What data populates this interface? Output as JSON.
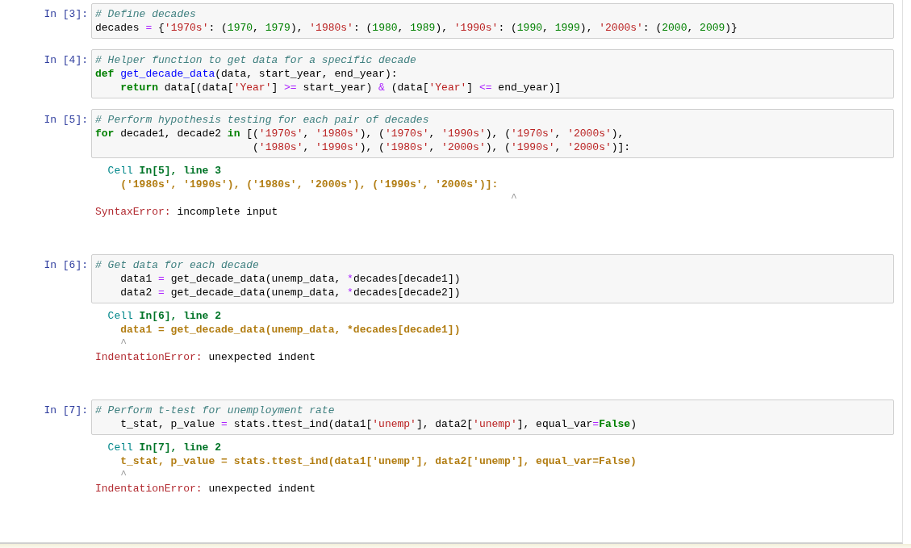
{
  "cells": [
    {
      "prompt": "In [3]:",
      "input": [
        [
          {
            "kind": "comment",
            "text": "# Define decades"
          }
        ],
        [
          {
            "kind": "plain",
            "text": "decades "
          },
          {
            "kind": "operator",
            "text": "="
          },
          {
            "kind": "plain",
            "text": " {"
          },
          {
            "kind": "string",
            "text": "'1970s'"
          },
          {
            "kind": "plain",
            "text": ": ("
          },
          {
            "kind": "number",
            "text": "1970"
          },
          {
            "kind": "plain",
            "text": ", "
          },
          {
            "kind": "number",
            "text": "1979"
          },
          {
            "kind": "plain",
            "text": "), "
          },
          {
            "kind": "string",
            "text": "'1980s'"
          },
          {
            "kind": "plain",
            "text": ": ("
          },
          {
            "kind": "number",
            "text": "1980"
          },
          {
            "kind": "plain",
            "text": ", "
          },
          {
            "kind": "number",
            "text": "1989"
          },
          {
            "kind": "plain",
            "text": "), "
          },
          {
            "kind": "string",
            "text": "'1990s'"
          },
          {
            "kind": "plain",
            "text": ": ("
          },
          {
            "kind": "number",
            "text": "1990"
          },
          {
            "kind": "plain",
            "text": ", "
          },
          {
            "kind": "number",
            "text": "1999"
          },
          {
            "kind": "plain",
            "text": "), "
          },
          {
            "kind": "string",
            "text": "'2000s'"
          },
          {
            "kind": "plain",
            "text": ": ("
          },
          {
            "kind": "number",
            "text": "2000"
          },
          {
            "kind": "plain",
            "text": ", "
          },
          {
            "kind": "number",
            "text": "2009"
          },
          {
            "kind": "plain",
            "text": ")}"
          }
        ]
      ]
    },
    {
      "prompt": "In [4]:",
      "input": [
        [
          {
            "kind": "comment",
            "text": "# Helper function to get data for a specific decade"
          }
        ],
        [
          {
            "kind": "keyword",
            "text": "def "
          },
          {
            "kind": "function",
            "text": "get_decade_data"
          },
          {
            "kind": "plain",
            "text": "(data, start_year, end_year):"
          }
        ],
        [
          {
            "kind": "keyword",
            "text": "    return"
          },
          {
            "kind": "plain",
            "text": " data[(data["
          },
          {
            "kind": "string",
            "text": "'Year'"
          },
          {
            "kind": "plain",
            "text": "] "
          },
          {
            "kind": "operator",
            "text": ">="
          },
          {
            "kind": "plain",
            "text": " start_year) "
          },
          {
            "kind": "operator",
            "text": "&"
          },
          {
            "kind": "plain",
            "text": " (data["
          },
          {
            "kind": "string",
            "text": "'Year'"
          },
          {
            "kind": "plain",
            "text": "] "
          },
          {
            "kind": "operator",
            "text": "<="
          },
          {
            "kind": "plain",
            "text": " end_year)]"
          }
        ]
      ]
    },
    {
      "prompt": "In [5]:",
      "input": [
        [
          {
            "kind": "comment",
            "text": "# Perform hypothesis testing for each pair of decades"
          }
        ],
        [
          {
            "kind": "keyword",
            "text": "for"
          },
          {
            "kind": "plain",
            "text": " decade1, decade2 "
          },
          {
            "kind": "keyword",
            "text": "in"
          },
          {
            "kind": "plain",
            "text": " [("
          },
          {
            "kind": "string",
            "text": "'1970s'"
          },
          {
            "kind": "plain",
            "text": ", "
          },
          {
            "kind": "string",
            "text": "'1980s'"
          },
          {
            "kind": "plain",
            "text": "), ("
          },
          {
            "kind": "string",
            "text": "'1970s'"
          },
          {
            "kind": "plain",
            "text": ", "
          },
          {
            "kind": "string",
            "text": "'1990s'"
          },
          {
            "kind": "plain",
            "text": "), ("
          },
          {
            "kind": "string",
            "text": "'1970s'"
          },
          {
            "kind": "plain",
            "text": ", "
          },
          {
            "kind": "string",
            "text": "'2000s'"
          },
          {
            "kind": "plain",
            "text": "),"
          }
        ],
        [
          {
            "kind": "plain",
            "text": "                         ("
          },
          {
            "kind": "string",
            "text": "'1980s'"
          },
          {
            "kind": "plain",
            "text": ", "
          },
          {
            "kind": "string",
            "text": "'1990s'"
          },
          {
            "kind": "plain",
            "text": "), ("
          },
          {
            "kind": "string",
            "text": "'1980s'"
          },
          {
            "kind": "plain",
            "text": ", "
          },
          {
            "kind": "string",
            "text": "'2000s'"
          },
          {
            "kind": "plain",
            "text": "), ("
          },
          {
            "kind": "string",
            "text": "'1990s'"
          },
          {
            "kind": "plain",
            "text": ", "
          },
          {
            "kind": "string",
            "text": "'2000s'"
          },
          {
            "kind": "plain",
            "text": ")]:"
          }
        ]
      ],
      "output": [
        [
          {
            "kind": "tb-cell",
            "text": "  Cell "
          },
          {
            "kind": "tb-location",
            "text": "In[5], line 3"
          }
        ],
        [
          {
            "kind": "tb-source",
            "text": "    ('1980s', '1990s'), ('1980s', '2000s'), ('1990s', '2000s')]:"
          }
        ],
        [
          {
            "kind": "tb-caret",
            "text": "                                                                  ^"
          }
        ],
        [
          {
            "kind": "error-name",
            "text": "SyntaxError:"
          },
          {
            "kind": "plain",
            "text": " incomplete input"
          }
        ]
      ]
    },
    {
      "prompt": "In [6]:",
      "input": [
        [
          {
            "kind": "comment",
            "text": "# Get data for each decade"
          }
        ],
        [
          {
            "kind": "plain",
            "text": "    data1 "
          },
          {
            "kind": "operator",
            "text": "="
          },
          {
            "kind": "plain",
            "text": " get_decade_data(unemp_data, "
          },
          {
            "kind": "operator",
            "text": "*"
          },
          {
            "kind": "plain",
            "text": "decades[decade1])"
          }
        ],
        [
          {
            "kind": "plain",
            "text": "    data2 "
          },
          {
            "kind": "operator",
            "text": "="
          },
          {
            "kind": "plain",
            "text": " get_decade_data(unemp_data, "
          },
          {
            "kind": "operator",
            "text": "*"
          },
          {
            "kind": "plain",
            "text": "decades[decade2])"
          }
        ]
      ],
      "output": [
        [
          {
            "kind": "tb-cell",
            "text": "  Cell "
          },
          {
            "kind": "tb-location",
            "text": "In[6], line 2"
          }
        ],
        [
          {
            "kind": "tb-source",
            "text": "    data1 = get_decade_data(unemp_data, *decades[decade1])"
          }
        ],
        [
          {
            "kind": "tb-caret",
            "text": "    ^"
          }
        ],
        [
          {
            "kind": "error-name",
            "text": "IndentationError:"
          },
          {
            "kind": "plain",
            "text": " unexpected indent"
          }
        ]
      ]
    },
    {
      "prompt": "In [7]:",
      "input": [
        [
          {
            "kind": "comment",
            "text": "# Perform t-test for unemployment rate"
          }
        ],
        [
          {
            "kind": "plain",
            "text": "    t_stat, p_value "
          },
          {
            "kind": "operator",
            "text": "="
          },
          {
            "kind": "plain",
            "text": " stats.ttest_ind(data1["
          },
          {
            "kind": "string",
            "text": "'unemp'"
          },
          {
            "kind": "plain",
            "text": "], data2["
          },
          {
            "kind": "string",
            "text": "'unemp'"
          },
          {
            "kind": "plain",
            "text": "], equal_var"
          },
          {
            "kind": "operator",
            "text": "="
          },
          {
            "kind": "keyword",
            "text": "False"
          },
          {
            "kind": "plain",
            "text": ")"
          }
        ]
      ],
      "output": [
        [
          {
            "kind": "tb-cell",
            "text": "  Cell "
          },
          {
            "kind": "tb-location",
            "text": "In[7], line 2"
          }
        ],
        [
          {
            "kind": "tb-source",
            "text": "    t_stat, p_value = stats.ttest_ind(data1['unemp'], data2['unemp'], equal_var=False)"
          }
        ],
        [
          {
            "kind": "tb-caret",
            "text": "    ^"
          }
        ],
        [
          {
            "kind": "error-name",
            "text": "IndentationError:"
          },
          {
            "kind": "plain",
            "text": " unexpected indent"
          }
        ]
      ]
    }
  ]
}
